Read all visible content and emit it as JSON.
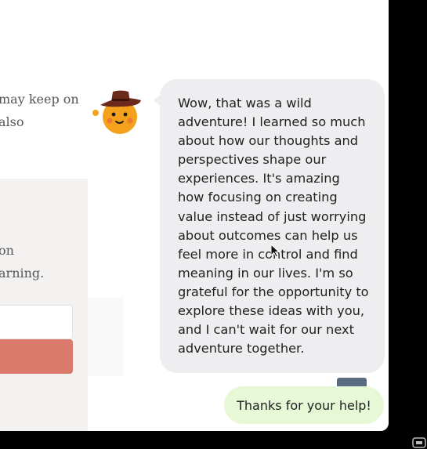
{
  "background_fragments": {
    "line1": "may keep on",
    "line2": "also",
    "line3": "on",
    "line4": "arning."
  },
  "assistant": {
    "avatar_icon": "cowboy-emoji-icon",
    "message": "Wow, that was a wild adventure! I learned so much about how our thoughts and perspectives shape our experiences. It's amazing how focusing on creating value instead of just worrying about outcomes can help us feel more in control and find meaning in our lives. I'm so grateful for the opportunity to explore these ideas with you, and I can't wait for our next adventure together."
  },
  "user": {
    "message": "Thanks for your help!"
  },
  "colors": {
    "assistant_bubble": "#eeeef0",
    "user_bubble": "#e6f8d6",
    "action_button": "#d97a6a",
    "avatar_face": "#f4a11d",
    "hat": "#6b2a1c"
  }
}
